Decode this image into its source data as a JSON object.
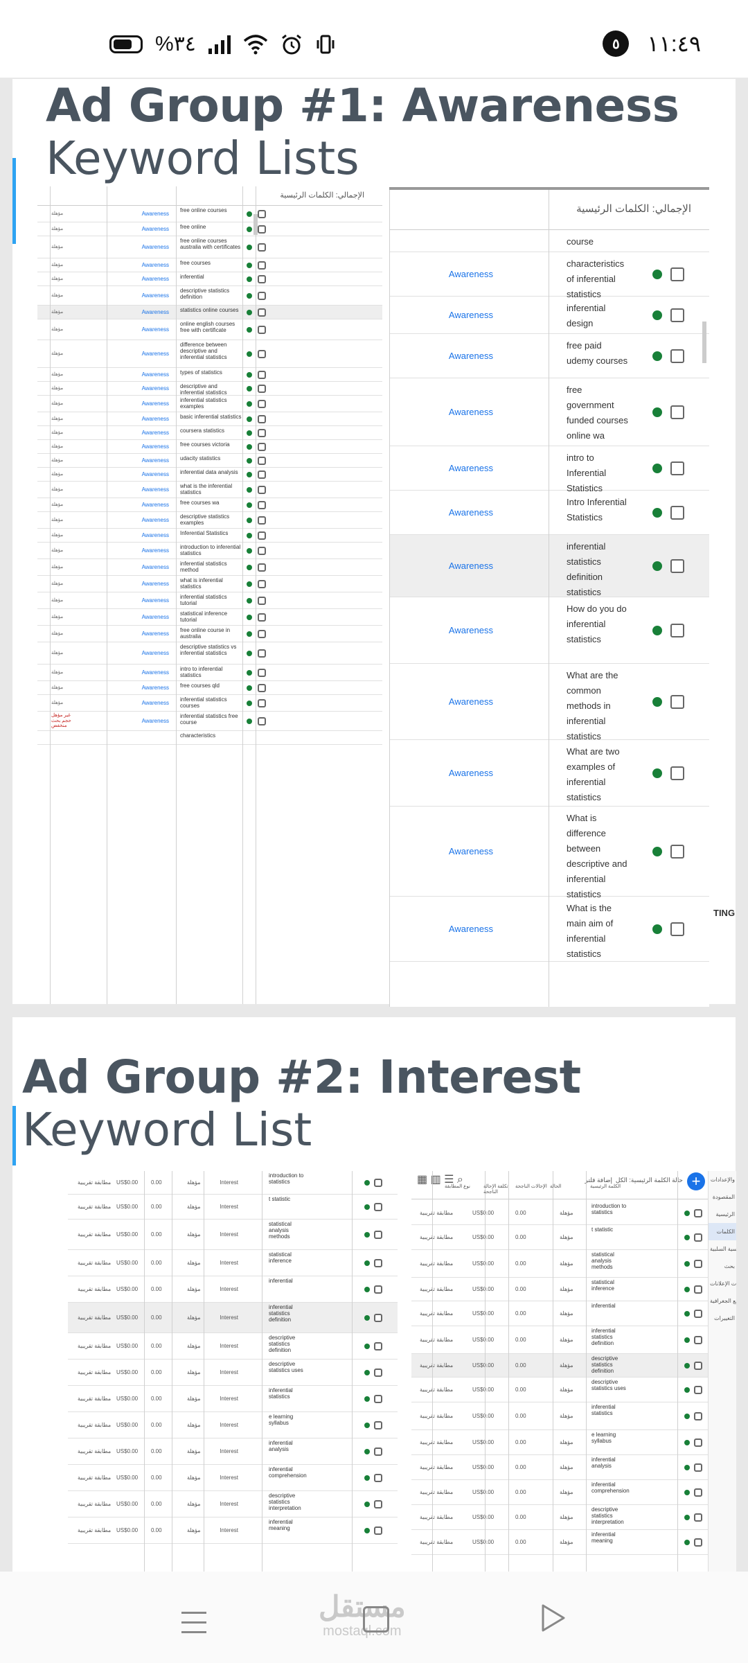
{
  "status_bar": {
    "battery": "%٣٤",
    "time": "١١:٤٩",
    "notification_count": "٥"
  },
  "section1": {
    "title": "Ad Group #1: Awareness",
    "subtitle": "Keyword Lists",
    "left_header": "الإجمالي: الكلمات الرئيسية",
    "status_text": "مؤهلة",
    "last_status_lines": [
      "غير مؤهل",
      "حجم بحث",
      "منخفض"
    ],
    "left_rows": [
      {
        "kw": "free online courses",
        "grp": "Awareness"
      },
      {
        "kw": "free online",
        "grp": "Awareness"
      },
      {
        "kw": "free online courses australia with certificates",
        "grp": "Awareness"
      },
      {
        "kw": "free courses",
        "grp": "Awareness"
      },
      {
        "kw": "inferential",
        "grp": "Awareness"
      },
      {
        "kw": "descriptive statistics definition",
        "grp": "Awareness"
      },
      {
        "kw": "statistics online courses",
        "grp": "Awareness"
      },
      {
        "kw": "online english courses free with certificate",
        "grp": "Awareness"
      },
      {
        "kw": "difference between descriptive and inferential statistics",
        "grp": "Awareness"
      },
      {
        "kw": "types of statistics",
        "grp": "Awareness"
      },
      {
        "kw": "descriptive and inferential statistics",
        "grp": "Awareness"
      },
      {
        "kw": "inferential statistics examples",
        "grp": "Awareness"
      },
      {
        "kw": "basic inferential statistics",
        "grp": "Awareness"
      },
      {
        "kw": "coursera statistics",
        "grp": "Awareness"
      },
      {
        "kw": "free courses victoria",
        "grp": "Awareness"
      },
      {
        "kw": "udacity statistics",
        "grp": "Awareness"
      },
      {
        "kw": "inferential data analysis",
        "grp": "Awareness"
      },
      {
        "kw": "what is the inferential statistics",
        "grp": "Awareness"
      },
      {
        "kw": "free courses wa",
        "grp": "Awareness"
      },
      {
        "kw": "descriptive statistics examples",
        "grp": "Awareness"
      },
      {
        "kw": "Inferential Statistics",
        "grp": "Awareness"
      },
      {
        "kw": "introduction to inferential statistics",
        "grp": "Awareness"
      },
      {
        "kw": "inferential statistics method",
        "grp": "Awareness"
      },
      {
        "kw": "what is inferential statistics",
        "grp": "Awareness"
      },
      {
        "kw": "inferential statistics tutorial",
        "grp": "Awareness"
      },
      {
        "kw": "statistical inference tutorial",
        "grp": "Awareness"
      },
      {
        "kw": "free online course in australia",
        "grp": "Awareness"
      },
      {
        "kw": "descriptive statistics vs inferential statistics",
        "grp": "Awareness"
      },
      {
        "kw": "intro to inferential statistics",
        "grp": "Awareness"
      },
      {
        "kw": "free courses qld",
        "grp": "Awareness"
      },
      {
        "kw": "inferential statistics courses",
        "grp": "Awareness"
      },
      {
        "kw": "inferential statistics free course",
        "grp": "Awareness"
      },
      {
        "kw": "characteristics",
        "grp": ""
      }
    ],
    "right_header": "الإجمالي: الكلمات الرئيسية",
    "right_rows": [
      {
        "kw": "course",
        "grp": ""
      },
      {
        "kw": "characteristics of inferential statistics",
        "grp": "Awareness"
      },
      {
        "kw": "inferential design",
        "grp": "Awareness"
      },
      {
        "kw": "free paid udemy courses",
        "grp": "Awareness"
      },
      {
        "kw": "free government funded courses online wa",
        "grp": "Awareness"
      },
      {
        "kw": "intro to Inferential Statistics",
        "grp": "Awareness"
      },
      {
        "kw": "Intro Inferential Statistics",
        "grp": "Awareness"
      },
      {
        "kw": "inferential statistics definition statistics",
        "grp": "Awareness"
      },
      {
        "kw": "How do you do inferential statistics",
        "grp": "Awareness"
      },
      {
        "kw": "What are the common methods in inferential statistics",
        "grp": "Awareness"
      },
      {
        "kw": "What are two examples of inferential statistics",
        "grp": "Awareness"
      },
      {
        "kw": "What is difference between descriptive and inferential statistics",
        "grp": "Awareness"
      },
      {
        "kw": "What is the main aim of inferential statistics",
        "grp": "Awareness"
      }
    ],
    "edge_text": "TING"
  },
  "section2": {
    "title": "Ad Group #2: Interest",
    "subtitle": "Keyword List",
    "match_type": "مطابقة تقريبية",
    "cost": "US$0.00",
    "conv": "0.00",
    "status_text": "مؤهلة",
    "group": "Interest",
    "toolbar_filter": "حالة الكلمة الرئيسية: الكل",
    "toolbar_add": "إضافة فلتر",
    "right_headers": [
      "الكلمة الرئيسية",
      "الحالة",
      "الإحالات الناجحة",
      "تكلفة الإحالة الناجحة",
      "نوع المطابقة"
    ],
    "rows": [
      "introduction to statistics",
      "t statistic",
      "statistical analysis methods",
      "statistical inference",
      "inferential",
      "inferential statistics definition",
      "descriptive statistics definition",
      "descriptive statistics uses",
      "inferential statistics",
      "e learning syllabus",
      "inferential analysis",
      "inferential comprehension",
      "descriptive statistics interpretation",
      "inferential meaning"
    ],
    "side_menu": [
      "والإعدادات",
      "المقصودة",
      "الرئيسية",
      "الكلمات",
      "الرئيسية السلبية",
      "بحث",
      "ملحقات الإعلانات",
      "المواقع الجغرافية",
      "التغييرات"
    ]
  },
  "nav": {
    "watermark": "مستقل",
    "watermark_sub": "mostaql.com"
  }
}
